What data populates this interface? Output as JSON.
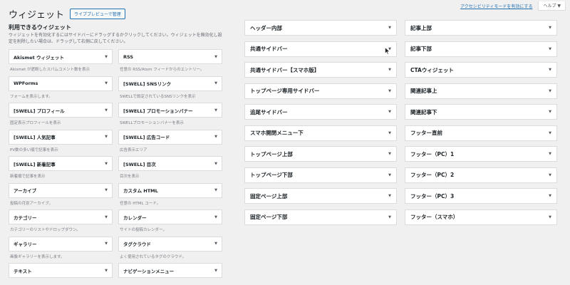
{
  "topbar": {
    "accessibility_link": "アクセシビリティモードを有効にする",
    "help_label": "ヘルプ ▼"
  },
  "header": {
    "title": "ウィジェット",
    "preview_button": "ライブプレビューで管理"
  },
  "available": {
    "title": "利用できるウィジェット",
    "description": "ウィジェットを有効化するにはサイドバーにドラッグするかクリックしてください。ウィジェットを無効化し設定を削除したい場合は、ドラッグして右側に戻してください。"
  },
  "widgets": [
    {
      "label": "Akismet ウィジェット",
      "desc": "Akismet が遮断したスパムコメント数を表示"
    },
    {
      "label": "RSS",
      "desc": "任意の RSS/Atom フィードからのエントリー。"
    },
    {
      "label": "WPForms",
      "desc": "フォームを表示します。"
    },
    {
      "label": "[SWELL] SNSリンク",
      "desc": "SWELLで設定されているSNSリンクを表示"
    },
    {
      "label": "[SWELL] プロフィール",
      "desc": "固定表示プロフィールを表示"
    },
    {
      "label": "[SWELL] プロモーションバナー",
      "desc": "SWELLプロモーションバナーを表示"
    },
    {
      "label": "[SWELL] 人気記事",
      "desc": "PV数の多い順で記事を表示"
    },
    {
      "label": "[SWELL] 広告コード",
      "desc": "広告表示エリア"
    },
    {
      "label": "[SWELL] 新着記事",
      "desc": "新着順で記事を表示"
    },
    {
      "label": "[SWELL] 目次",
      "desc": "目次を表示"
    },
    {
      "label": "アーカイブ",
      "desc": "投稿の月別アーカイブ。"
    },
    {
      "label": "カスタム HTML",
      "desc": "任意の HTML コード。"
    },
    {
      "label": "カテゴリー",
      "desc": "カテゴリーのリストやドロップダウン。"
    },
    {
      "label": "カレンダー",
      "desc": "サイトの投稿カレンダー。"
    },
    {
      "label": "ギャラリー",
      "desc": "画像ギャラリーを表示します。"
    },
    {
      "label": "タグクラウド",
      "desc": "よく使用されているタグのクラウド。"
    },
    {
      "label": "テキスト",
      "desc": ""
    },
    {
      "label": "ナビゲーションメニュー",
      "desc": ""
    }
  ],
  "sidebars_left": [
    {
      "label": "ヘッダー内部"
    },
    {
      "label": "共通サイドバー"
    },
    {
      "label": "共通サイドバー【スマホ版】"
    },
    {
      "label": "トップページ専用サイドバー"
    },
    {
      "label": "追尾サイドバー"
    },
    {
      "label": "スマホ開閉メニュー下"
    },
    {
      "label": "トップページ上部"
    },
    {
      "label": "トップページ下部"
    },
    {
      "label": "固定ページ上部"
    },
    {
      "label": "固定ページ下部"
    }
  ],
  "sidebars_right": [
    {
      "label": "記事上部"
    },
    {
      "label": "記事下部"
    },
    {
      "label": "CTAウィジェット"
    },
    {
      "label": "関連記事上"
    },
    {
      "label": "関連記事下"
    },
    {
      "label": "フッター直前"
    },
    {
      "label": "フッター（PC）1"
    },
    {
      "label": "フッター（PC）2"
    },
    {
      "label": "フッター（PC）3"
    },
    {
      "label": "フッター（スマホ）"
    }
  ],
  "icons": {
    "caret": "caret-down-icon",
    "cursor": "mouse-pointer-icon"
  },
  "colors": {
    "link": "#2271b1",
    "background": "#f0f0f1"
  }
}
